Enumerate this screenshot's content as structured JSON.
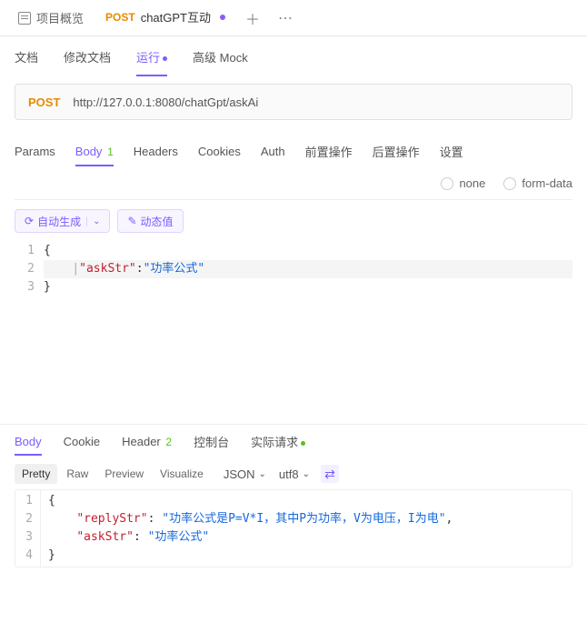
{
  "topTabs": {
    "overview": "项目概览",
    "activeMethod": "POST",
    "activeName": "chatGPT互动"
  },
  "subTabs": {
    "doc": "文档",
    "editDoc": "修改文档",
    "run": "运行",
    "mock": "高级 Mock"
  },
  "urlBar": {
    "method": "POST",
    "url": "http://127.0.0.1:8080/chatGpt/askAi"
  },
  "reqTabs": {
    "params": "Params",
    "body": "Body",
    "bodyBadge": "1",
    "headers": "Headers",
    "cookies": "Cookies",
    "auth": "Auth",
    "pre": "前置操作",
    "post": "后置操作",
    "settings": "设置"
  },
  "bodyTypes": {
    "none": "none",
    "formData": "form-data"
  },
  "toolbar": {
    "autoGen": "自动生成",
    "dynamic": "动态值"
  },
  "reqEditor": {
    "lines": [
      "1",
      "2",
      "3"
    ],
    "key": "\"askStr\"",
    "val": "\"功率公式\""
  },
  "respTabs": {
    "body": "Body",
    "cookie": "Cookie",
    "header": "Header",
    "headerBadge": "2",
    "console": "控制台",
    "actual": "实际请求"
  },
  "respToolbar": {
    "pretty": "Pretty",
    "raw": "Raw",
    "preview": "Preview",
    "visualize": "Visualize",
    "format": "JSON",
    "encoding": "utf8"
  },
  "respEditor": {
    "lines": [
      "1",
      "2",
      "3",
      "4"
    ],
    "k1": "\"replyStr\"",
    "v1": "\"功率公式是P=V*I，其中P为功率，V为电压，I为电\"",
    "k2": "\"askStr\"",
    "v2": "\"功率公式\""
  }
}
